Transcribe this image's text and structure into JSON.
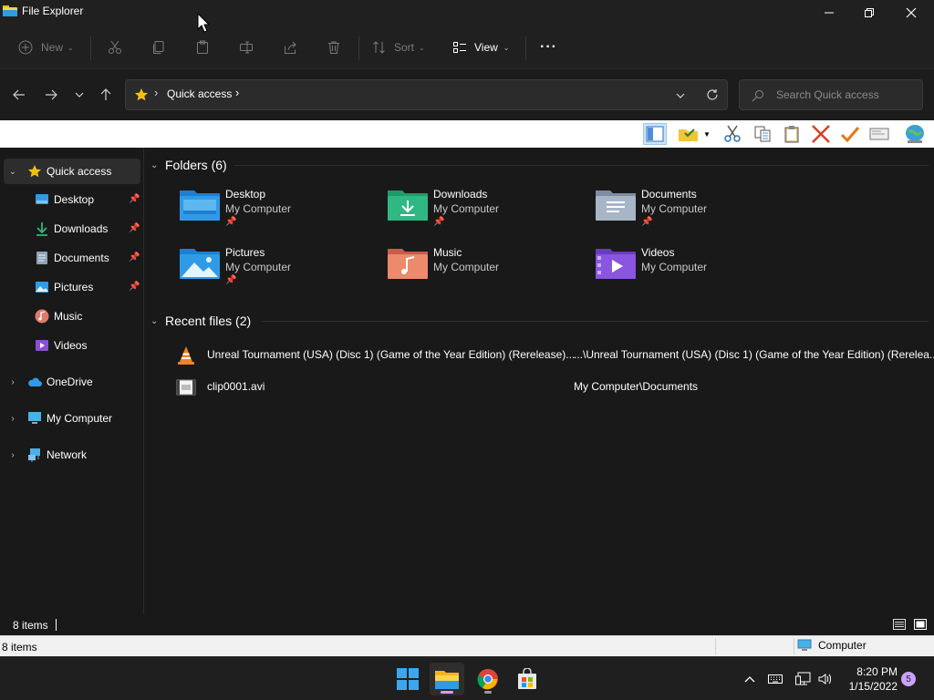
{
  "window": {
    "title": "File Explorer"
  },
  "toolbar": {
    "new_label": "New",
    "sort_label": "Sort",
    "view_label": "View",
    "more_label": "···"
  },
  "address": {
    "root": "Quick access",
    "search_placeholder": "Search Quick access"
  },
  "sidebar": {
    "quick_access": "Quick access",
    "pinned": [
      {
        "label": "Desktop"
      },
      {
        "label": "Downloads"
      },
      {
        "label": "Documents"
      },
      {
        "label": "Pictures"
      }
    ],
    "music": "Music",
    "videos": "Videos",
    "onedrive": "OneDrive",
    "my_computer": "My Computer",
    "network": "Network"
  },
  "main": {
    "folders_header": "Folders (6)",
    "folders": [
      {
        "name": "Desktop",
        "location": "My Computer",
        "pinned": true,
        "icon": "desktop-folder-icon"
      },
      {
        "name": "Downloads",
        "location": "My Computer",
        "pinned": true,
        "icon": "downloads-folder-icon"
      },
      {
        "name": "Documents",
        "location": "My Computer",
        "pinned": true,
        "icon": "documents-folder-icon"
      },
      {
        "name": "Pictures",
        "location": "My Computer",
        "pinned": true,
        "icon": "pictures-folder-icon"
      },
      {
        "name": "Music",
        "location": "My Computer",
        "pinned": false,
        "icon": "music-folder-icon"
      },
      {
        "name": "Videos",
        "location": "My Computer",
        "pinned": false,
        "icon": "videos-folder-icon"
      }
    ],
    "recent_header": "Recent files (2)",
    "recent": [
      {
        "name": "Unreal Tournament (USA) (Disc 1) (Game of the Year Edition) (Rerelease)...",
        "location": "...\\Unreal Tournament (USA) (Disc 1) (Game of the Year Edition) (Rerelea...",
        "icon": "vlc-icon"
      },
      {
        "name": "clip0001.avi",
        "location": "My Computer\\Documents",
        "icon": "video-file-icon"
      }
    ]
  },
  "status": {
    "items": "8 items"
  },
  "legacy_status": {
    "items": "8 items",
    "zone": "Computer"
  },
  "taskbar": {
    "time": "8:20 PM",
    "date": "1/15/2022",
    "notifications": "5"
  },
  "colors": {
    "accent": "#c9a2ff",
    "folder_blue": "#2f9be8",
    "star": "#f2c012"
  }
}
